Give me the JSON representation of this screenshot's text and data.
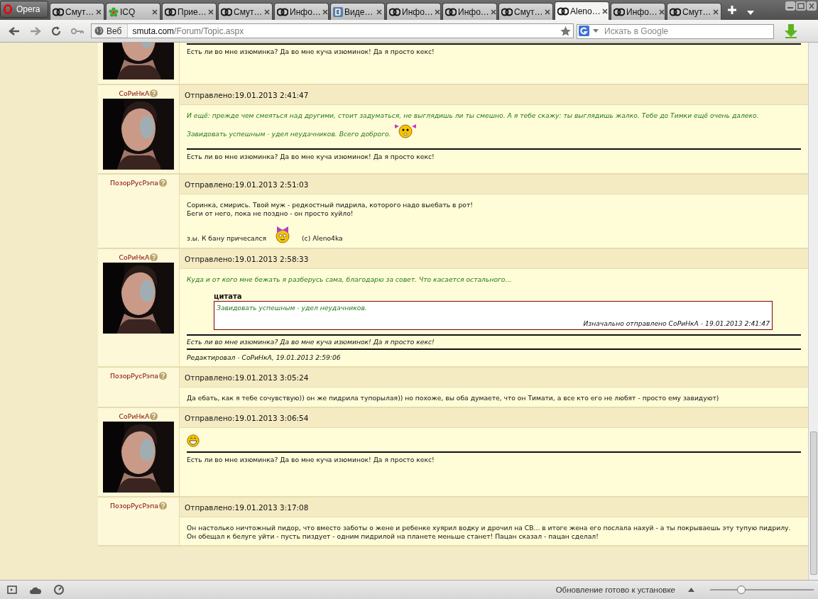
{
  "browser": {
    "menu_button": "Opera",
    "tabs": [
      {
        "label": "Смут…",
        "kind": "site",
        "selected": false
      },
      {
        "label": "ICQ",
        "kind": "icq",
        "selected": false
      },
      {
        "label": "Прие…",
        "kind": "site",
        "selected": false
      },
      {
        "label": "Смут…",
        "kind": "site",
        "selected": false
      },
      {
        "label": "Инфо…",
        "kind": "site",
        "selected": false
      },
      {
        "label": "Виде…",
        "kind": "vk",
        "selected": false
      },
      {
        "label": "Инфо…",
        "kind": "site",
        "selected": false
      },
      {
        "label": "Инфо…",
        "kind": "site",
        "selected": false
      },
      {
        "label": "Смут…",
        "kind": "site",
        "selected": false
      },
      {
        "label": "Aleno…",
        "kind": "site",
        "selected": true
      },
      {
        "label": "Инфо…",
        "kind": "site",
        "selected": false
      },
      {
        "label": "Смут…",
        "kind": "site",
        "selected": false
      }
    ],
    "address": {
      "badge": "Веб",
      "host": "smuta.com",
      "path": "/Forum/Topic.aspx"
    },
    "search": {
      "placeholder": "Искать в Google"
    }
  },
  "posts": [
    {
      "avatar": true,
      "signature": {
        "text": "Есть ли во мне изюминка? Да во мне куча изюминок! Да я просто кекс!",
        "italic": false
      }
    },
    {
      "author": "СоРиНкА",
      "avatar": true,
      "time": "Отправлено:19.01.2013 2:41:47",
      "message": [
        {
          "kind": "green",
          "parts": [
            {
              "kind": "text",
              "text": "И ещё: прежде чем смеяться над другими, стоит задуматься, не выглядишь ли ты смешно. А я тебе скажу: ты выглядишь жалко. Тебе до Тимки ещё очень далеко."
            }
          ]
        },
        {
          "kind": "green",
          "parts": [
            {
              "kind": "text",
              "text": "Завидовать успешным - удел неудачников. Всего доброго."
            },
            {
              "kind": "pigtails"
            }
          ]
        }
      ],
      "signature": {
        "text": "Есть ли во мне изюминка? Да во мне куча изюминок! Да я просто кекс!",
        "italic": false
      }
    },
    {
      "author": "ПозорРусРэпа",
      "avatar": false,
      "time": "Отправлено:19.01.2013 2:51:03",
      "message": [
        {
          "kind": "plain",
          "parts": [
            {
              "kind": "text",
              "text": "Соринка, смирись. Твой муж - редкостный пидрила, которого надо выебать в рот!"
            }
          ]
        },
        {
          "kind": "plain",
          "parts": [
            {
              "kind": "text",
              "text": "Беги от него, пока не поздно - он просто хуйло!"
            }
          ]
        },
        {
          "kind": "spaced",
          "parts": [
            {
              "kind": "text",
              "text": "з.ы. К бану причесался"
            },
            {
              "kind": "bow"
            },
            {
              "kind": "text",
              "text": "(с) Aleno4ka"
            }
          ]
        }
      ]
    },
    {
      "author": "СоРиНкА",
      "avatar": true,
      "time": "Отправлено:19.01.2013 2:58:33",
      "message": [
        {
          "kind": "green",
          "parts": [
            {
              "kind": "text",
              "text": "Куда и от кого мне бежать я разберусь сама, благодарю за совет. Что касается остального…"
            }
          ]
        }
      ],
      "quote": {
        "title": "цитата",
        "text": "Завидовать успешным - удел неудачников.",
        "attribution": "Изначально отправлено СоРиНкА - 19.01.2013 2:41:47"
      },
      "signature": {
        "text": "Есть ли во мне изюминка? Да во мне куча изюминок! Да я просто кекс!",
        "italic": true
      },
      "edited": "Редактировал - СоРиНкА, 19.01.2013 2:59:06"
    },
    {
      "author": "ПозорРусРэпа",
      "avatar": false,
      "time": "Отправлено:19.01.2013 3:05:24",
      "message": [
        {
          "kind": "plain",
          "parts": [
            {
              "kind": "text",
              "text": "Да ебать, как я тебе сочувствую)) он же пидрила тупорылая)) но похоже, вы оба думаете, что он Тимати, а все кто его не любят - просто ему завидуют)"
            }
          ]
        }
      ]
    },
    {
      "author": "СоРиНкА",
      "avatar": true,
      "time": "Отправлено:19.01.2013 3:06:54",
      "message": [
        {
          "kind": "plain",
          "parts": [
            {
              "kind": "grin"
            }
          ]
        }
      ],
      "signature": {
        "text": "Есть ли во мне изюминка? Да во мне куча изюминок! Да я просто кекс!",
        "italic": false
      }
    },
    {
      "author": "ПозорРусРэпа",
      "avatar": false,
      "time": "Отправлено:19.01.2013 3:17:08",
      "message": [
        {
          "kind": "plain",
          "parts": [
            {
              "kind": "text",
              "text": "Он настолько ничтожный пидор, что вместо заботы о жене и ребенке хуярил водку и дрочил на СВ... в итоге жена его послала нахуй - а ты покрываешь эту тупую пидрилу."
            }
          ]
        },
        {
          "kind": "plain",
          "parts": [
            {
              "kind": "text",
              "text": "Он обещал к белуге уйти - пусть пиздует - одним пидрилой на планете меньше станет! Пацан сказал - пацан сделал!"
            }
          ]
        }
      ]
    }
  ],
  "status_bar": {
    "message": "Обновление готово к установке",
    "zoom": {
      "level": 0.3
    }
  }
}
